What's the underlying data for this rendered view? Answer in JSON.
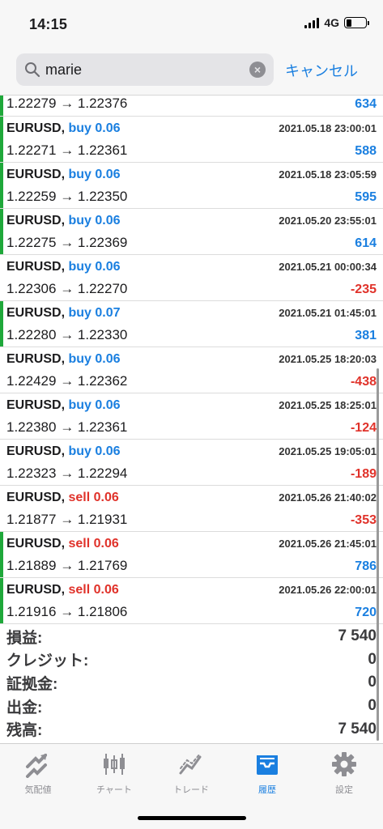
{
  "status": {
    "time": "14:15",
    "network": "4G"
  },
  "search": {
    "value": "marie",
    "clear": "×",
    "cancel": "キャンセル"
  },
  "trades": [
    {
      "partial": true,
      "from": "1.22279",
      "to": "1.22376",
      "profit": "634",
      "positive": true,
      "green": true
    },
    {
      "symbol": "EURUSD,",
      "side": "buy",
      "lots": "0.06",
      "date": "2021.05.18 23:00:01",
      "from": "1.22271",
      "to": "1.22361",
      "profit": "588",
      "positive": true,
      "green": true
    },
    {
      "symbol": "EURUSD,",
      "side": "buy",
      "lots": "0.06",
      "date": "2021.05.18 23:05:59",
      "from": "1.22259",
      "to": "1.22350",
      "profit": "595",
      "positive": true,
      "green": true
    },
    {
      "symbol": "EURUSD,",
      "side": "buy",
      "lots": "0.06",
      "date": "2021.05.20 23:55:01",
      "from": "1.22275",
      "to": "1.22369",
      "profit": "614",
      "positive": true,
      "green": true
    },
    {
      "symbol": "EURUSD,",
      "side": "buy",
      "lots": "0.06",
      "date": "2021.05.21 00:00:34",
      "from": "1.22306",
      "to": "1.22270",
      "profit": "-235",
      "positive": false,
      "green": false
    },
    {
      "symbol": "EURUSD,",
      "side": "buy",
      "lots": "0.07",
      "date": "2021.05.21 01:45:01",
      "from": "1.22280",
      "to": "1.22330",
      "profit": "381",
      "positive": true,
      "green": true
    },
    {
      "symbol": "EURUSD,",
      "side": "buy",
      "lots": "0.06",
      "date": "2021.05.25 18:20:03",
      "from": "1.22429",
      "to": "1.22362",
      "profit": "-438",
      "positive": false,
      "green": false
    },
    {
      "symbol": "EURUSD,",
      "side": "buy",
      "lots": "0.06",
      "date": "2021.05.25 18:25:01",
      "from": "1.22380",
      "to": "1.22361",
      "profit": "-124",
      "positive": false,
      "green": false
    },
    {
      "symbol": "EURUSD,",
      "side": "buy",
      "lots": "0.06",
      "date": "2021.05.25 19:05:01",
      "from": "1.22323",
      "to": "1.22294",
      "profit": "-189",
      "positive": false,
      "green": false
    },
    {
      "symbol": "EURUSD,",
      "side": "sell",
      "lots": "0.06",
      "date": "2021.05.26 21:40:02",
      "from": "1.21877",
      "to": "1.21931",
      "profit": "-353",
      "positive": false,
      "green": false
    },
    {
      "symbol": "EURUSD,",
      "side": "sell",
      "lots": "0.06",
      "date": "2021.05.26 21:45:01",
      "from": "1.21889",
      "to": "1.21769",
      "profit": "786",
      "positive": true,
      "green": true
    },
    {
      "symbol": "EURUSD,",
      "side": "sell",
      "lots": "0.06",
      "date": "2021.05.26 22:00:01",
      "from": "1.21916",
      "to": "1.21806",
      "profit": "720",
      "positive": true,
      "green": true
    }
  ],
  "arrow": "→",
  "summary": [
    {
      "label": "損益:",
      "value": "7 540"
    },
    {
      "label": "クレジット:",
      "value": "0"
    },
    {
      "label": "証拠金:",
      "value": "0"
    },
    {
      "label": "出金:",
      "value": "0"
    },
    {
      "label": "残高:",
      "value": "7 540"
    }
  ],
  "tabs": [
    {
      "label": "気配値",
      "icon": "quotes-icon",
      "active": false
    },
    {
      "label": "チャート",
      "icon": "chart-icon",
      "active": false
    },
    {
      "label": "トレード",
      "icon": "trade-icon",
      "active": false
    },
    {
      "label": "履歴",
      "icon": "history-icon",
      "active": true
    },
    {
      "label": "設定",
      "icon": "settings-icon",
      "active": false
    }
  ],
  "colors": {
    "buy": "#1a7fe0",
    "sell": "#e0322a",
    "green_marker": "#1fa83a",
    "accent": "#1a7fe0"
  }
}
